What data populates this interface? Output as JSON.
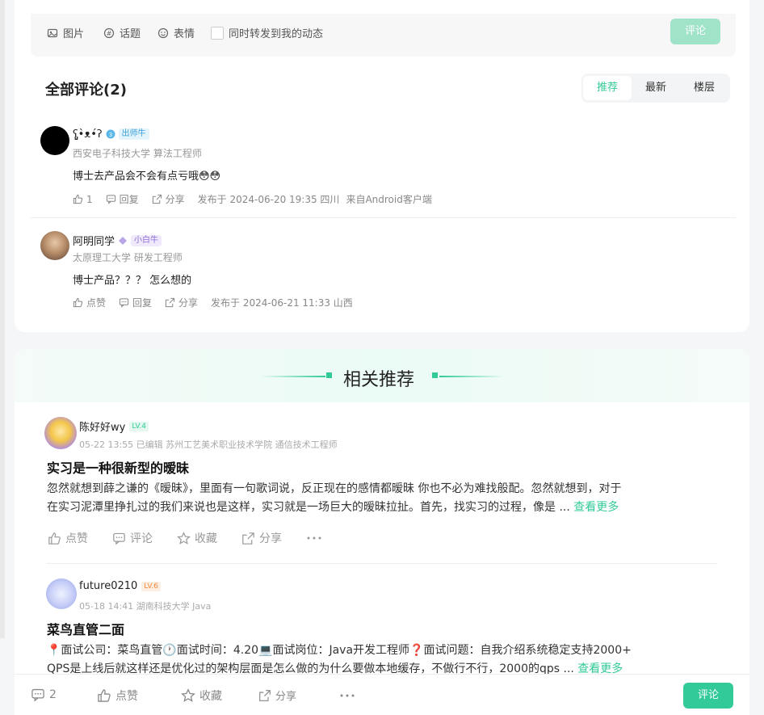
{
  "editor": {
    "image_label": "图片",
    "topic_label": "话题",
    "emoji_label": "表情",
    "forward_label": "同时转发到我的动态",
    "submit_label": "评论"
  },
  "comments_section": {
    "title": "全部评论(2)",
    "sort_tabs": [
      "推荐",
      "最新",
      "楼层"
    ],
    "comments": [
      {
        "username": "ʕ̡̢̡•̀ᴥ•́ʔ",
        "badge": "出师牛",
        "subtitle": "西安电子科技大学 算法工程师",
        "text": "博士去产品会不会有点亏哦😳😳",
        "like_count": "1",
        "reply_label": "回复",
        "share_label": "分享",
        "meta": "发布于 2024-06-20 19:35 四川",
        "source": "来自Android客户端"
      },
      {
        "username": "阿明同学",
        "badge": "小白牛",
        "subtitle": "太原理工大学 研发工程师",
        "text": "博士产品？？？ 怎么想的",
        "like_label": "点赞",
        "reply_label": "回复",
        "share_label": "分享",
        "meta": "发布于 2024-06-21 11:33 山西"
      }
    ]
  },
  "recommend": {
    "title": "相关推荐",
    "posts": [
      {
        "username": "陈好好wy",
        "level": "LV.4",
        "meta": "05-22 13:55  已编辑  苏州工艺美术职业技术学院 通信技术工程师",
        "title": "实习是一种很新型的暧昧",
        "body_line1": "忽然就想到薛之谦的《暧昧》，里面有一句歌词说，反正现在的感情都暧昧 你也不必为难找般配。忽然就想到，对于",
        "body_line2": "在实习泥潭里挣扎过的我们来说也是这样，实习就是一场巨大的暧昧拉扯。首先，找实习的过程，像是 ...",
        "see_more": "查看更多",
        "like_label": "点赞",
        "comment_label": "评论",
        "fav_label": "收藏",
        "share_label": "分享"
      },
      {
        "username": "future0210",
        "level": "LV.6",
        "meta": "05-18 14:41  湖南科技大学 Java",
        "title": "菜鸟直管二面",
        "body_line1": "📍面试公司：菜鸟直管🕐面试时间：4.20💻面试岗位：Java开发工程师❓面试问题：自我介绍系统稳定支持2000+",
        "body_line2": "QPS是上线后就这样还是优化过的架构层面是怎么做的为什么要做本地缓存，不做行不行，2000的qps ...",
        "see_more": "查看更多"
      }
    ]
  },
  "bottom_bar": {
    "comment_count": "2",
    "like_label": "点赞",
    "fav_label": "收藏",
    "share_label": "分享",
    "submit_label": "评论"
  },
  "colors": {
    "accent": "#32ca99",
    "accent_disabled": "#9fe3c9"
  }
}
